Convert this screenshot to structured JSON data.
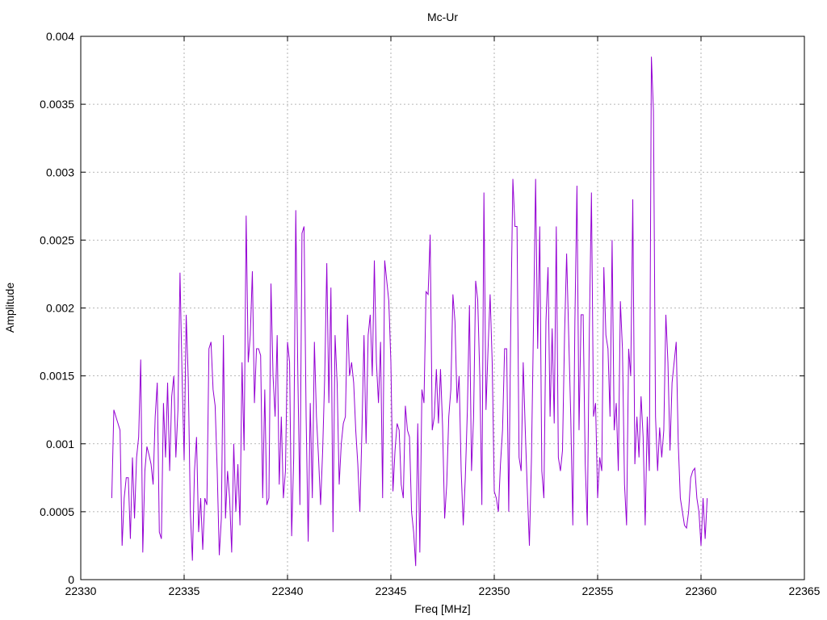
{
  "chart_data": {
    "type": "line",
    "title": "Mc-Ur",
    "xlabel": "Freq [MHz]",
    "ylabel": "Amplitude",
    "xlim": [
      22330,
      22365
    ],
    "ylim": [
      0,
      0.004
    ],
    "x_ticks": [
      22330,
      22335,
      22340,
      22345,
      22350,
      22355,
      22360,
      22365
    ],
    "x_tick_labels": [
      "22330",
      "22335",
      "22340",
      "22345",
      "22350",
      "22355",
      "22360",
      "22365"
    ],
    "y_ticks": [
      0,
      0.0005,
      0.001,
      0.0015,
      0.002,
      0.0025,
      0.003,
      0.0035,
      0.004
    ],
    "y_tick_labels": [
      "0",
      "0.0005",
      "0.001",
      "0.0015",
      "0.002",
      "0.0025",
      "0.003",
      "0.0035",
      "0.004"
    ],
    "grid": true,
    "series": [
      {
        "color": "#9400d3",
        "x_start": 22331.5,
        "x_step": 0.1,
        "values": [
          0.0006,
          0.00125,
          0.0012,
          0.00115,
          0.0011,
          0.00025,
          0.0006,
          0.00075,
          0.00075,
          0.0003,
          0.0009,
          0.00045,
          0.0009,
          0.00105,
          0.00162,
          0.0002,
          0.0008,
          0.00098,
          0.00092,
          0.00085,
          0.0007,
          0.0012,
          0.00145,
          0.00035,
          0.0003,
          0.0013,
          0.0009,
          0.00145,
          0.0008,
          0.00135,
          0.0015,
          0.0009,
          0.00125,
          0.00226,
          0.0015,
          0.00088,
          0.00195,
          0.00148,
          0.0005,
          0.00014,
          0.0008,
          0.00105,
          0.00035,
          0.0006,
          0.00022,
          0.0006,
          0.00055,
          0.0017,
          0.00175,
          0.0014,
          0.00128,
          0.0008,
          0.00018,
          0.00045,
          0.0018,
          0.00045,
          0.0008,
          0.0006,
          0.0002,
          0.001,
          0.0005,
          0.00085,
          0.0004,
          0.0016,
          0.00095,
          0.00268,
          0.0016,
          0.0018,
          0.00227,
          0.0013,
          0.0017,
          0.0017,
          0.00165,
          0.0006,
          0.0014,
          0.00055,
          0.0006,
          0.00218,
          0.0015,
          0.0012,
          0.0018,
          0.0007,
          0.0012,
          0.0006,
          0.0008,
          0.00175,
          0.0016,
          0.00032,
          0.0009,
          0.00272,
          0.0015,
          0.00055,
          0.00255,
          0.0026,
          0.0012,
          0.00028,
          0.0013,
          0.0006,
          0.00175,
          0.0012,
          0.0009,
          0.00055,
          0.00095,
          0.0015,
          0.00233,
          0.0013,
          0.00215,
          0.00035,
          0.0018,
          0.00145,
          0.0007,
          0.001,
          0.00115,
          0.0012,
          0.00195,
          0.0015,
          0.0016,
          0.00145,
          0.0011,
          0.00085,
          0.0005,
          0.0011,
          0.0018,
          0.001,
          0.0018,
          0.00195,
          0.0015,
          0.00235,
          0.0016,
          0.0013,
          0.00175,
          0.0006,
          0.00235,
          0.0022,
          0.00205,
          0.0016,
          0.00065,
          0.00095,
          0.00115,
          0.0011,
          0.0007,
          0.0006,
          0.00128,
          0.0011,
          0.00105,
          0.0005,
          0.00035,
          0.0001,
          0.00115,
          0.0002,
          0.0014,
          0.0013,
          0.00212,
          0.0021,
          0.00254,
          0.0011,
          0.0012,
          0.00155,
          0.00115,
          0.00155,
          0.00113,
          0.00045,
          0.0007,
          0.0012,
          0.0014,
          0.0021,
          0.0019,
          0.0013,
          0.0015,
          0.0008,
          0.0004,
          0.00075,
          0.00125,
          0.00202,
          0.0008,
          0.0012,
          0.0022,
          0.00206,
          0.0015,
          0.00055,
          0.00285,
          0.00125,
          0.0017,
          0.0021,
          0.0016,
          0.00065,
          0.0006,
          0.0005,
          0.00085,
          0.0011,
          0.0017,
          0.0017,
          0.0005,
          0.0019,
          0.00295,
          0.0026,
          0.0026,
          0.0009,
          0.0008,
          0.0016,
          0.0011,
          0.00065,
          0.00025,
          0.0009,
          0.0019,
          0.00295,
          0.0017,
          0.0026,
          0.0008,
          0.0006,
          0.0019,
          0.0023,
          0.0012,
          0.00185,
          0.00115,
          0.0026,
          0.0009,
          0.0008,
          0.00095,
          0.0018,
          0.0024,
          0.0018,
          0.0012,
          0.0004,
          0.0019,
          0.0029,
          0.0011,
          0.00195,
          0.00195,
          0.00085,
          0.0004,
          0.00185,
          0.00285,
          0.0012,
          0.0013,
          0.0006,
          0.0009,
          0.0008,
          0.0023,
          0.0018,
          0.0017,
          0.0012,
          0.0025,
          0.0011,
          0.0013,
          0.0008,
          0.00205,
          0.0017,
          0.0007,
          0.0004,
          0.0017,
          0.0015,
          0.0028,
          0.00085,
          0.0012,
          0.0009,
          0.00135,
          0.00105,
          0.0004,
          0.0012,
          0.0008,
          0.00385,
          0.00345,
          0.0012,
          0.0008,
          0.00112,
          0.0009,
          0.0011,
          0.00195,
          0.0016,
          0.00095,
          0.00145,
          0.0016,
          0.00175,
          0.001,
          0.0006,
          0.0005,
          0.0004,
          0.00038,
          0.0005,
          0.00075,
          0.0008,
          0.00082,
          0.0006,
          0.0005,
          0.00025,
          0.0006,
          0.0003,
          0.0006
        ]
      }
    ]
  }
}
